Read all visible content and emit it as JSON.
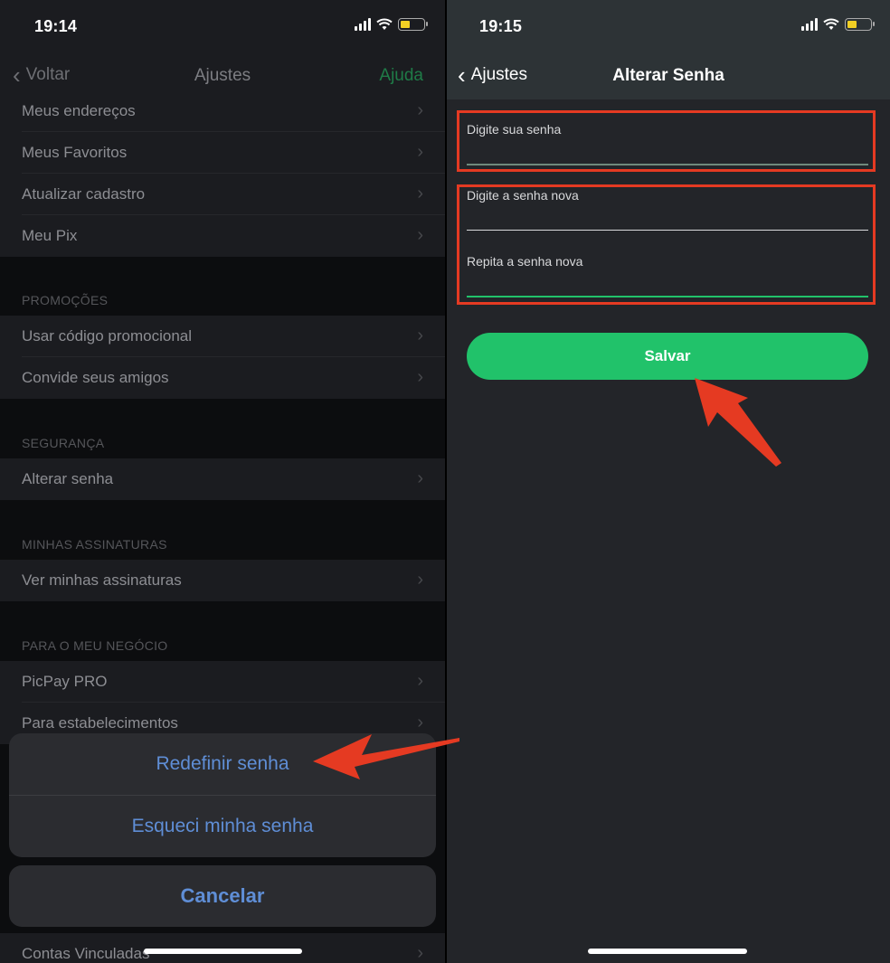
{
  "left": {
    "status": {
      "time": "19:14"
    },
    "nav": {
      "back_label": "Voltar",
      "title": "Ajustes",
      "help_label": "Ajuda"
    },
    "rows_top": [
      "Meus endereços",
      "Meus Favoritos",
      "Atualizar cadastro",
      "Meu Pix"
    ],
    "promo_header": "PROMOÇÕES",
    "rows_promo": [
      "Usar código promocional",
      "Convide seus amigos"
    ],
    "security_header": "SEGURANÇA",
    "rows_security": [
      "Alterar senha"
    ],
    "subs_header": "MINHAS ASSINATURAS",
    "rows_subs": [
      "Ver minhas assinaturas"
    ],
    "business_header": "PARA O MEU NEGÓCIO",
    "rows_business": [
      "PicPay PRO",
      "Para estabelecimentos"
    ],
    "row_bottom": "Contas Vinculadas",
    "sheet": {
      "redefinir": "Redefinir senha",
      "esqueci": "Esqueci minha senha",
      "cancelar": "Cancelar"
    }
  },
  "right": {
    "status": {
      "time": "19:15"
    },
    "nav": {
      "back_label": "Ajustes",
      "title": "Alterar Senha"
    },
    "fields": {
      "current": {
        "label": "Digite sua senha",
        "value": ""
      },
      "new": {
        "label": "Digite a senha nova",
        "value": ""
      },
      "repeat": {
        "label": "Repita a senha nova",
        "value": ""
      }
    },
    "save_label": "Salvar"
  },
  "colors": {
    "accent_green": "#21c26a",
    "ios_link_blue": "#5f8ed6",
    "annotation_red": "#e53a22"
  },
  "icons": [
    "chevron-left-icon",
    "chevron-right-icon",
    "signal-icon",
    "wifi-icon",
    "battery-icon",
    "red-arrow-annotation"
  ]
}
